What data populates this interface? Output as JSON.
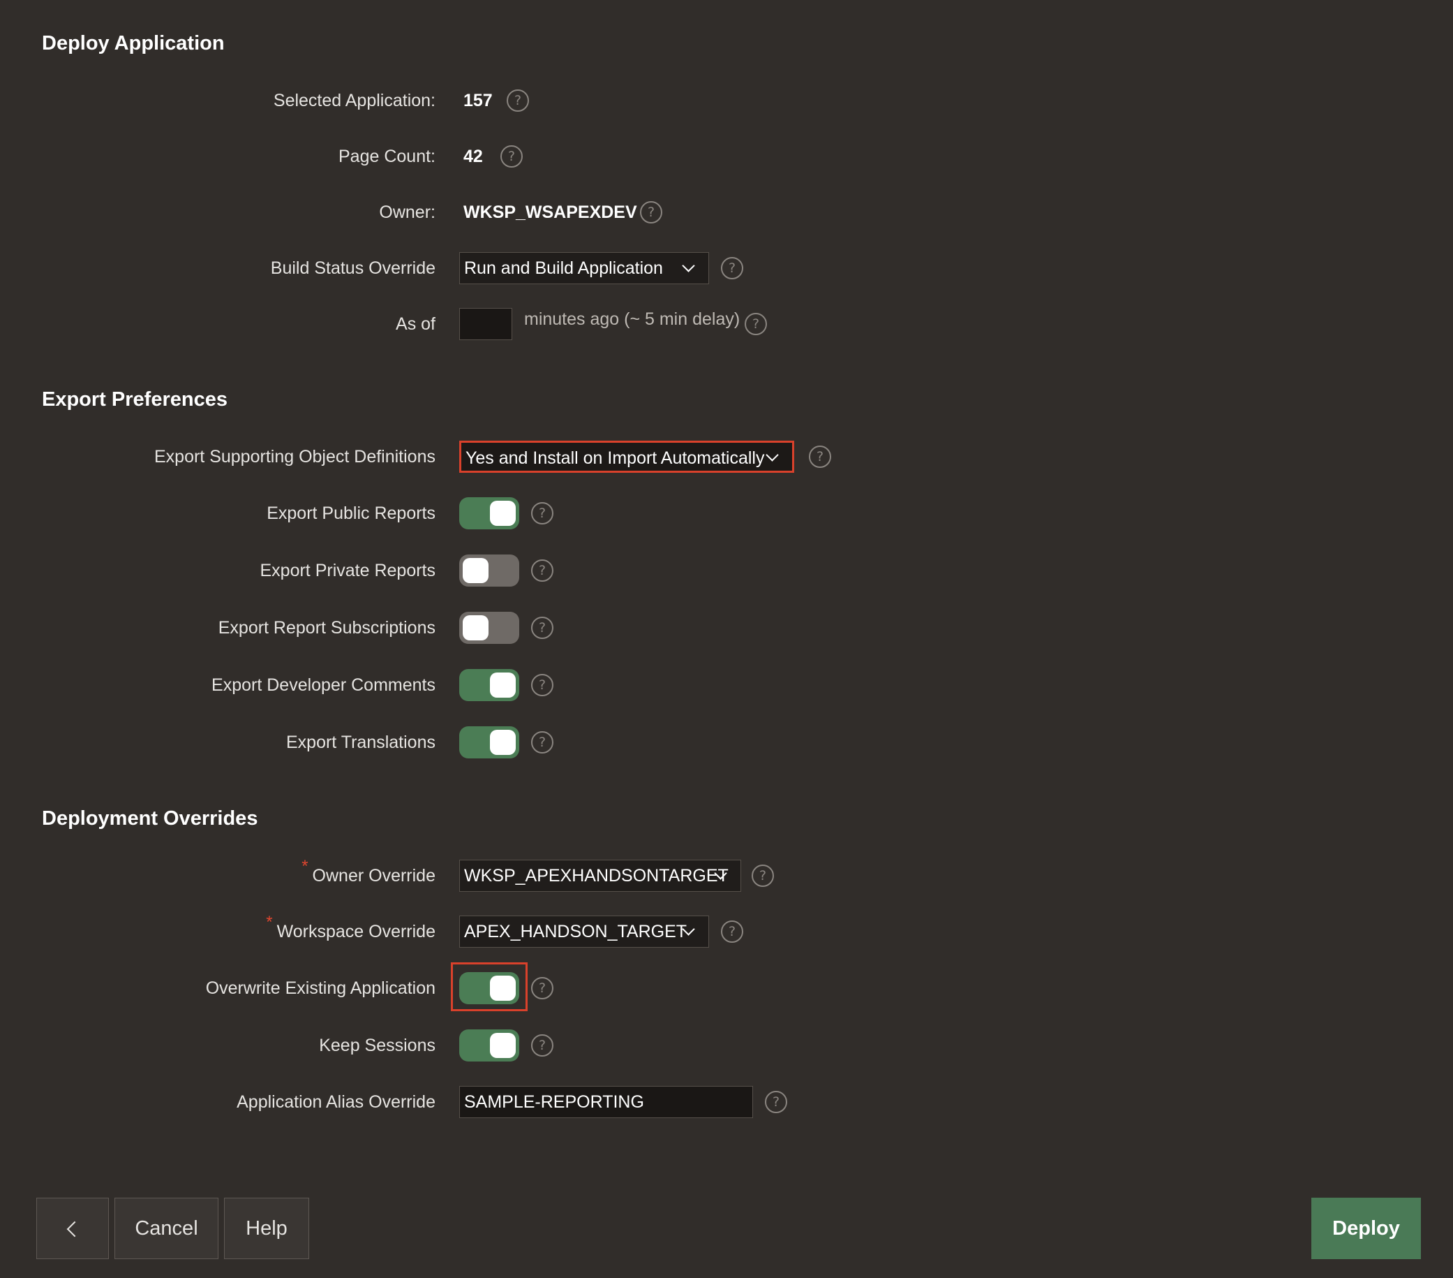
{
  "sections": {
    "deploy": {
      "title": "Deploy Application"
    },
    "export": {
      "title": "Export Preferences"
    },
    "overrides": {
      "title": "Deployment Overrides"
    }
  },
  "deploy": {
    "selected_application": {
      "label": "Selected Application:",
      "value": "157"
    },
    "page_count": {
      "label": "Page Count:",
      "value": "42"
    },
    "owner": {
      "label": "Owner:",
      "value": "WKSP_WSAPEXDEV"
    },
    "build_status": {
      "label": "Build Status Override",
      "value": "Run and Build Application"
    },
    "as_of": {
      "label": "As of",
      "value": "",
      "suffix": "minutes ago (~ 5 min delay)"
    }
  },
  "export": {
    "supporting_objects": {
      "label": "Export Supporting Object Definitions",
      "value": "Yes and Install on Import Automatically"
    },
    "public_reports": {
      "label": "Export Public Reports",
      "on": true
    },
    "private_reports": {
      "label": "Export Private Reports",
      "on": false
    },
    "report_subscriptions": {
      "label": "Export Report Subscriptions",
      "on": false
    },
    "developer_comments": {
      "label": "Export Developer Comments",
      "on": true
    },
    "translations": {
      "label": "Export Translations",
      "on": true
    }
  },
  "overrides": {
    "owner_override": {
      "label": "Owner Override",
      "value": "WKSP_APEXHANDSONTARGET",
      "required": "*"
    },
    "workspace_override": {
      "label": "Workspace Override",
      "value": "APEX_HANDSON_TARGET",
      "required": "*"
    },
    "overwrite_existing": {
      "label": "Overwrite Existing Application",
      "on": true
    },
    "keep_sessions": {
      "label": "Keep Sessions",
      "on": true
    },
    "alias_override": {
      "label": "Application Alias Override",
      "value": "SAMPLE-REPORTING"
    }
  },
  "help_glyph": "?",
  "footer": {
    "cancel_label": "Cancel",
    "help_label": "Help",
    "deploy_label": "Deploy"
  },
  "colors": {
    "background": "#312d2a",
    "toggle_on": "#4b7d55",
    "toggle_off": "#6f6a66",
    "highlight": "#d9412b",
    "primary_button": "#4a7a56"
  }
}
